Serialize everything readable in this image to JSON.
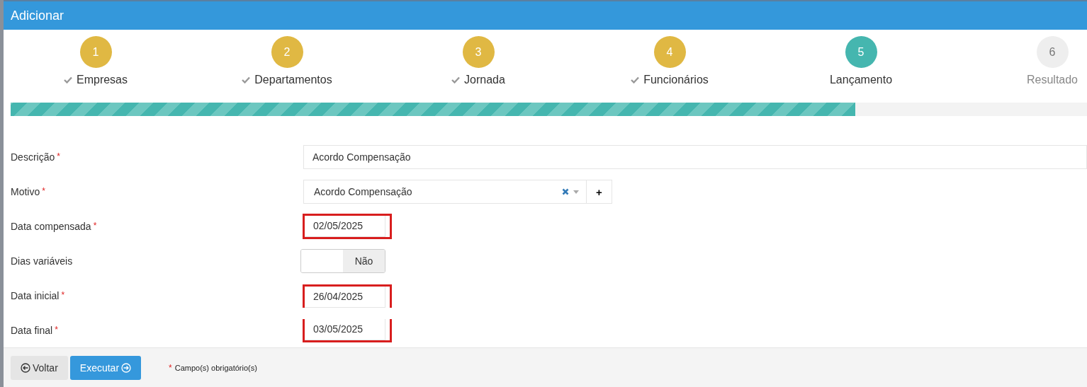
{
  "window": {
    "title": "Adicionar"
  },
  "steps": [
    {
      "number": "1",
      "label": "Empresas",
      "done": true,
      "current": false
    },
    {
      "number": "2",
      "label": "Departamentos",
      "done": true,
      "current": false
    },
    {
      "number": "3",
      "label": "Jornada",
      "done": true,
      "current": false
    },
    {
      "number": "4",
      "label": "Funcionários",
      "done": true,
      "current": false
    },
    {
      "number": "5",
      "label": "Lançamento",
      "done": false,
      "current": true
    },
    {
      "number": "6",
      "label": "Resultado",
      "done": false,
      "current": false
    }
  ],
  "progress": {
    "level": 0.785
  },
  "fields": [
    {
      "kind": "text",
      "label": "Descrição",
      "required_mark": "*",
      "value": "Acordo Compensação",
      "highlighted": false
    },
    {
      "kind": "select",
      "label": "Motivo",
      "required_mark": "*",
      "value": "Acordo Compensação",
      "add_button": "+",
      "highlighted": false
    },
    {
      "kind": "date",
      "label": "Data compensada",
      "required_mark": "*",
      "value": "02/05/2025",
      "highlighted": true
    },
    {
      "kind": "toggle",
      "label": "Dias variáveis",
      "on": false,
      "off_text": "Não",
      "highlighted": false
    },
    {
      "kind": "date",
      "label": "Data inicial",
      "required_mark": "*",
      "value": "26/04/2025",
      "highlighted": true
    },
    {
      "kind": "date",
      "label": "Data final",
      "required_mark": "*",
      "value": "03/05/2025",
      "highlighted": true
    }
  ],
  "footer": {
    "back_button": "Voltar",
    "execute_button": "Executar",
    "required_mark": "*",
    "required_note": "Campo(s) obrigatório(s)"
  }
}
